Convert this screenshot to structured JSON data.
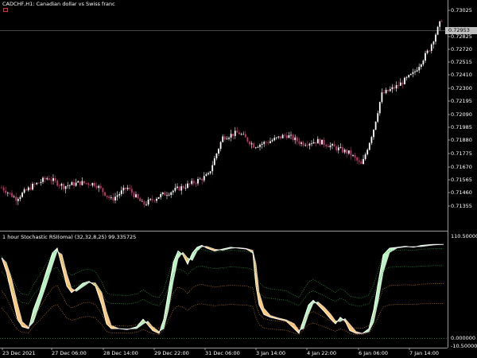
{
  "header": {
    "symbol_title": "CADCHF,H1:  Canadian dollar vs Swiss franc",
    "indicator_title": "1 hour Stochastic RSI(oma) (32,32,8,25) 99.335725"
  },
  "current_price": "0.72953",
  "price_axis": [
    "0.73025",
    "0.72825",
    "0.72720",
    "0.72515",
    "0.72410",
    "0.72300",
    "0.72195",
    "0.72090",
    "0.71985",
    "0.71880",
    "0.71775",
    "0.71670",
    "0.71565",
    "0.71460",
    "0.71355"
  ],
  "indicator_axis": [
    "110.500000",
    "0.000000",
    "-10.500000"
  ],
  "time_axis": [
    "23 Dec 2021",
    "27 Dec 06:00",
    "28 Dec 14:00",
    "29 Dec 22:00",
    "31 Dec 06:00",
    "3 Jan 14:00",
    "4 Jan 22:00",
    "6 Jan 06:00",
    "7 Jan 14:00"
  ],
  "colors": {
    "background": "#000000",
    "bull_candle": "#ffffff",
    "bear_candle": "#c8366e",
    "fill_up": "#b9f5c0",
    "fill_down": "#ffc97a",
    "line_main": "#ffffff",
    "line_green_dotted": "#2e9e3a",
    "line_orange_dotted": "#c87a20"
  },
  "chart_data": {
    "type": "line",
    "title": "CADCHF,H1:  Canadian dollar vs Swiss franc",
    "x": [
      "23 Dec 2021",
      "27 Dec 06:00",
      "28 Dec 14:00",
      "29 Dec 22:00",
      "31 Dec 06:00",
      "3 Jan 14:00",
      "4 Jan 22:00",
      "6 Jan 06:00",
      "7 Jan 14:00"
    ],
    "series": [
      {
        "values": [
          0.716,
          0.7167,
          0.716,
          0.716,
          0.7207,
          0.72,
          0.7196,
          0.7188,
          0.7275
        ]
      }
    ],
    "ylim": [
      0.713,
      0.731
    ],
    "grid": false
  }
}
